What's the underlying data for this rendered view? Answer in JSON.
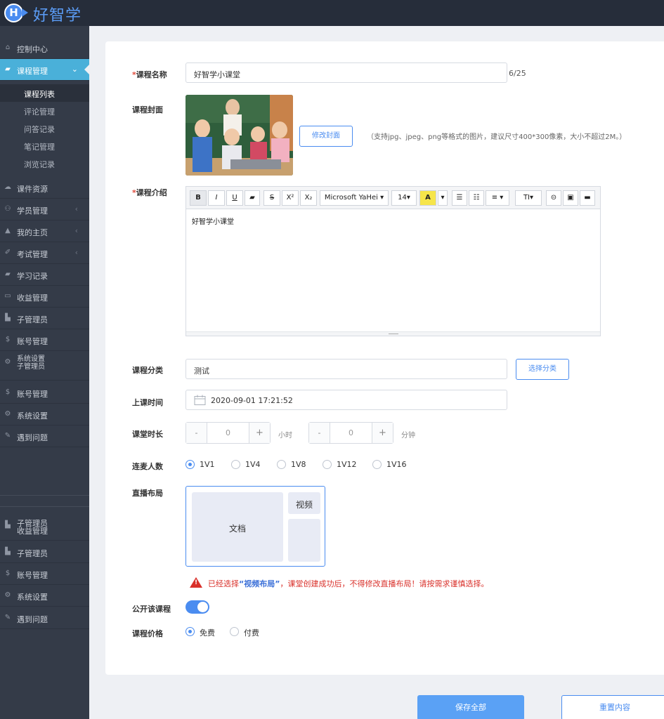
{
  "app": {
    "logo_letter": "H",
    "title": "好智学"
  },
  "sidebar": {
    "items": [
      {
        "label": "控制中心",
        "icon": "home-icon"
      },
      {
        "label": "课程管理",
        "icon": "book-icon",
        "active": true
      },
      {
        "label": "课件资源",
        "icon": "cloud-icon"
      },
      {
        "label": "学员管理",
        "icon": "users-icon"
      },
      {
        "label": "我的主页",
        "icon": "graduation-icon"
      },
      {
        "label": "考试管理",
        "icon": "exam-icon"
      },
      {
        "label": "学习记录",
        "icon": "book-icon"
      },
      {
        "label": "收益管理",
        "icon": "card-icon"
      },
      {
        "label": "子管理员",
        "icon": "lock-icon"
      },
      {
        "label": "账号管理",
        "icon": "dollar-icon"
      },
      {
        "label_top": "系统设置",
        "label_bottom": "子管理员",
        "icon": "gear-icon"
      },
      {
        "label": "账号管理",
        "icon": "dollar-icon"
      },
      {
        "label": "系统设置",
        "icon": "gear-icon"
      },
      {
        "label": "遇到问题",
        "icon": "pencil-icon"
      },
      {
        "label_top": "子管理员",
        "label_bottom": "收益管理",
        "icon": "lock-icon"
      },
      {
        "label": "子管理员",
        "icon": "lock-icon"
      },
      {
        "label": "账号管理",
        "icon": "dollar-icon"
      },
      {
        "label": "系统设置",
        "icon": "gear-icon"
      },
      {
        "label": "遇到问题",
        "icon": "pencil-icon"
      }
    ],
    "subitems": [
      {
        "label": "课程列表",
        "active": true
      },
      {
        "label": "评论管理"
      },
      {
        "label": "问答记录"
      },
      {
        "label": "笔记管理"
      },
      {
        "label": "浏览记录"
      }
    ]
  },
  "form": {
    "course_name": {
      "label": "课程名称",
      "required_mark": "*",
      "value": "好智学小课堂",
      "counter": "6/25"
    },
    "cover": {
      "label": "课程封面",
      "button": "修改封面",
      "hint": "（支持jpg、jpeg、png等格式的图片，建议尺寸400*300像素，大小不超过2M。）"
    },
    "intro": {
      "label": "课程介绍",
      "required_mark": "*",
      "content": "好智学小课堂",
      "toolbar": {
        "bold": "B",
        "italic": "I",
        "underline": "U",
        "eraser": "▰",
        "strike": "S",
        "superscript": "X²",
        "subscript": "X₂",
        "font": "Microsoft YaHei ▾",
        "size": "14▾",
        "color": "A",
        "color_dd": "▾",
        "ul": "☰",
        "ol": "☷",
        "align": "≡ ▾",
        "heading": "TI▾",
        "link": "⊝",
        "image": "▣",
        "video": "▬"
      }
    },
    "category": {
      "label": "课程分类",
      "value": "测试",
      "button": "选择分类"
    },
    "start_time": {
      "label": "上课时间",
      "value": "2020-09-01 17:21:52"
    },
    "duration": {
      "label": "课堂时长",
      "hours": {
        "minus": "-",
        "value": "0",
        "plus": "+",
        "unit": "小时"
      },
      "minutes": {
        "minus": "-",
        "value": "0",
        "plus": "+",
        "unit": "分钟"
      }
    },
    "mic_count": {
      "label": "连麦人数",
      "options": [
        "1V1",
        "1V4",
        "1V8",
        "1V12",
        "1V16"
      ],
      "selected": "1V1"
    },
    "live_layout": {
      "label": "直播布局",
      "doc": "文档",
      "video": "视频"
    },
    "warning": {
      "prefix": "已经选择",
      "highlight": "“视频布局”",
      "suffix": "，课堂创建成功后，不得修改直播布局！请按需求谨慎选择。"
    },
    "public": {
      "label": "公开该课程",
      "on": true
    },
    "price": {
      "label": "课程价格",
      "options": [
        "免费",
        "付费"
      ],
      "selected": "免费"
    }
  },
  "actions": {
    "save": "保存全部",
    "reset": "重置内容"
  },
  "colors": {
    "primary": "#4a8cf0",
    "sidebar": "#343b48",
    "active_nav": "#4ab0d9",
    "topbar": "#262d3a",
    "warning": "#d9302a"
  }
}
